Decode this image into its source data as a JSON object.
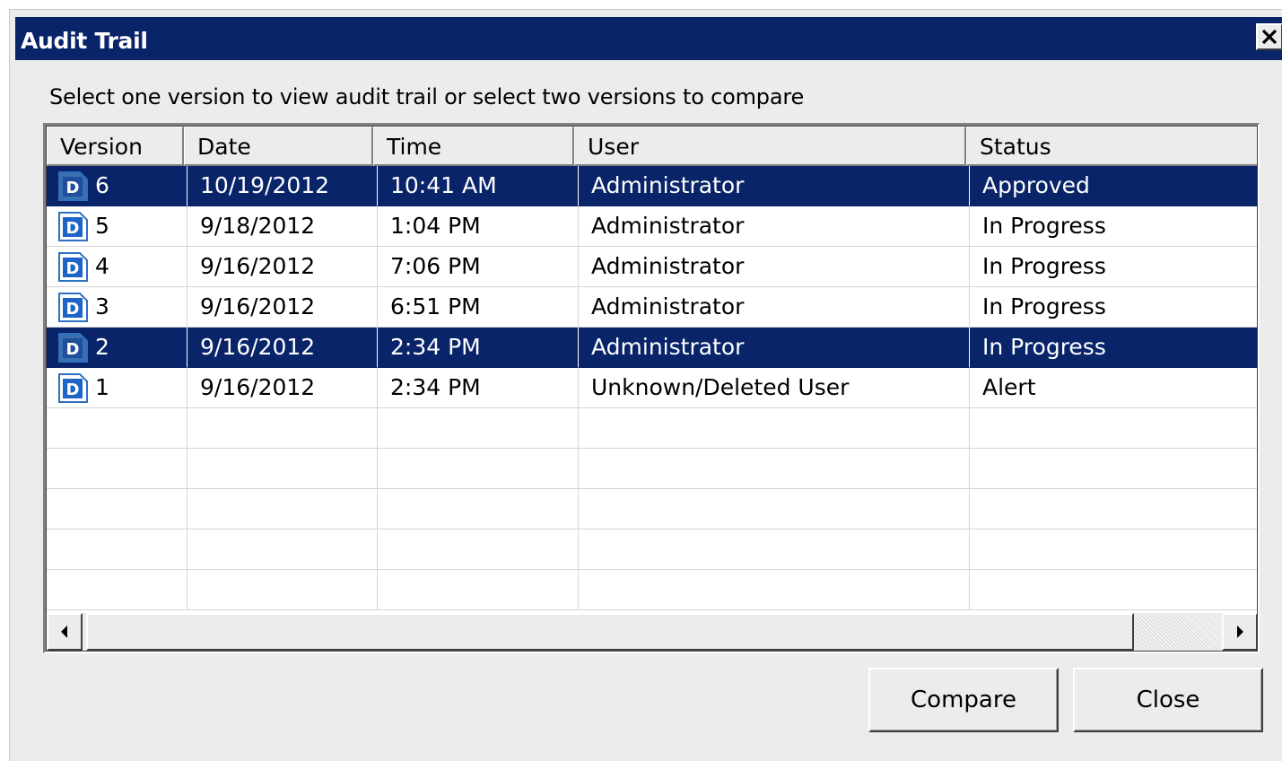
{
  "window": {
    "title": "Audit Trail",
    "close_glyph": "✕"
  },
  "instruction": "Select one version to view audit trail or select two versions to compare",
  "table": {
    "columns": [
      "Version",
      "Date",
      "Time",
      "User",
      "Status"
    ],
    "rows": [
      {
        "version": "6",
        "date": "10/19/2012",
        "time": "10:41 AM",
        "user": "Administrator",
        "status": "Approved",
        "selected": true,
        "icon": "document-d-icon"
      },
      {
        "version": "5",
        "date": "9/18/2012",
        "time": "1:04 PM",
        "user": "Administrator",
        "status": "In Progress",
        "selected": false,
        "icon": "document-d-icon"
      },
      {
        "version": "4",
        "date": "9/16/2012",
        "time": "7:06 PM",
        "user": "Administrator",
        "status": "In Progress",
        "selected": false,
        "icon": "document-d-icon"
      },
      {
        "version": "3",
        "date": "9/16/2012",
        "time": "6:51 PM",
        "user": "Administrator",
        "status": "In Progress",
        "selected": false,
        "icon": "document-d-icon"
      },
      {
        "version": "2",
        "date": "9/16/2012",
        "time": "2:34 PM",
        "user": "Administrator",
        "status": "In Progress",
        "selected": true,
        "icon": "document-d-icon"
      },
      {
        "version": "1",
        "date": "9/16/2012",
        "time": "2:34 PM",
        "user": "Unknown/Deleted User",
        "status": "Alert",
        "selected": false,
        "icon": "document-d-icon"
      }
    ],
    "icon_letter": "D",
    "empty_rows": 5
  },
  "buttons": {
    "compare": "Compare",
    "close": "Close"
  },
  "colors": {
    "titlebar": "#0a246a",
    "selection": "#0a246a",
    "dialog_bg": "#ececec"
  }
}
